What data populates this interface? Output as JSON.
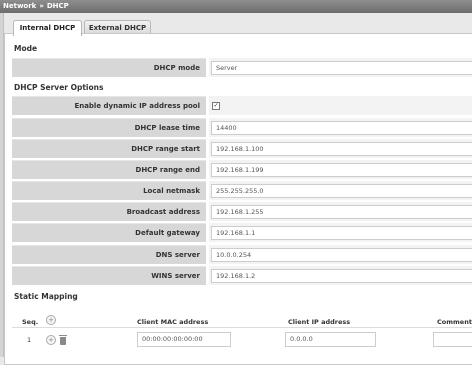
{
  "breadcrumb": {
    "parent": "Network",
    "separator": "»",
    "current": "DHCP"
  },
  "tabs": [
    {
      "label": "Internal DHCP",
      "active": true
    },
    {
      "label": "External DHCP",
      "active": false
    }
  ],
  "mode_section": {
    "title": "Mode",
    "dhcp_mode": {
      "label": "DHCP mode",
      "value": "Server"
    }
  },
  "options_section": {
    "title": "DHCP Server Options",
    "dynamic_pool": {
      "label": "Enable dynamic IP address pool",
      "checked": true,
      "check_glyph": "✓"
    },
    "lease_time": {
      "label": "DHCP lease time",
      "value": "14400"
    },
    "range_start": {
      "label": "DHCP range start",
      "value": "192.168.1.100"
    },
    "range_end": {
      "label": "DHCP range end",
      "value": "192.168.1.199"
    },
    "netmask": {
      "label": "Local netmask",
      "value": "255.255.255.0"
    },
    "broadcast": {
      "label": "Broadcast address",
      "value": "192.168.1.255"
    },
    "gateway": {
      "label": "Default gateway",
      "value": "192.168.1.1"
    },
    "dns": {
      "label": "DNS server",
      "value": "10.0.0.254"
    },
    "wins": {
      "label": "WINS server",
      "value": "192.168.1.2"
    }
  },
  "static_section": {
    "title": "Static Mapping",
    "columns": {
      "seq": "Seq.",
      "mac": "Client MAC address",
      "ip": "Client IP address",
      "comment": "Comment"
    },
    "rows": [
      {
        "seq": "1",
        "mac": "00:00:00:00:00:00",
        "ip": "0.0.0.0",
        "comment": ""
      }
    ],
    "add_glyph": "+"
  }
}
